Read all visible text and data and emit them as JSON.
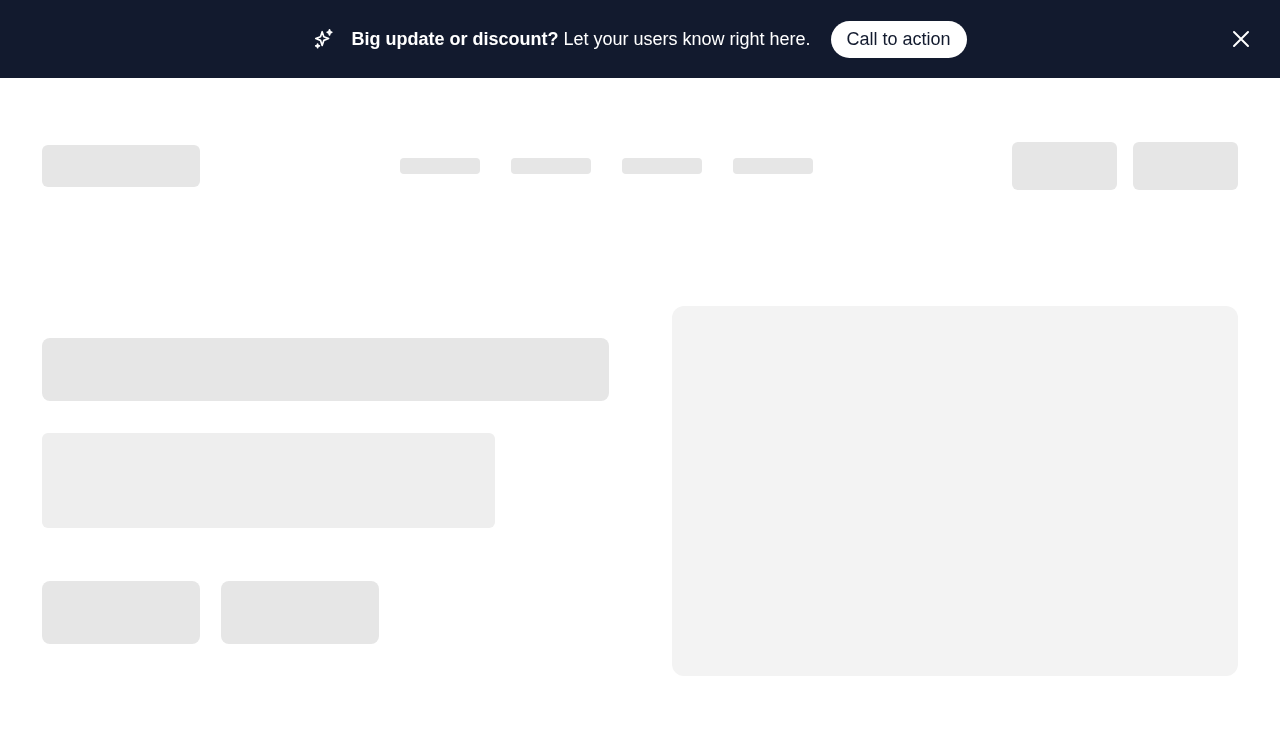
{
  "banner": {
    "message": "**Big update or discount?** Let your users know right here.",
    "cta": "Call to action"
  }
}
